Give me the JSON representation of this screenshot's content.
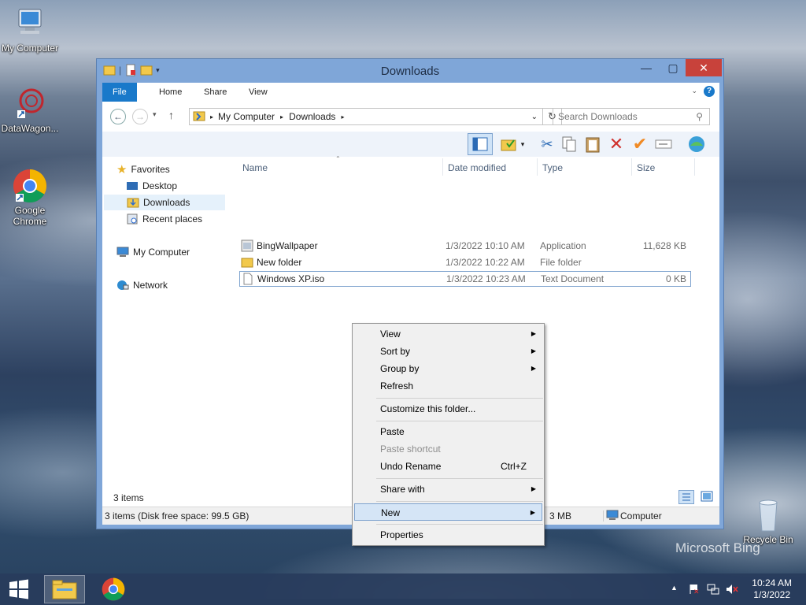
{
  "desktop": {
    "icons": [
      {
        "label": "My Computer"
      },
      {
        "label": "DataWagon..."
      },
      {
        "label": "Google Chrome"
      },
      {
        "label": "Recycle Bin"
      }
    ],
    "watermark": "Microsoft Bing"
  },
  "window": {
    "title": "Downloads",
    "ribbon_tabs": [
      "File",
      "Home",
      "Share",
      "View"
    ],
    "address": {
      "parts": [
        "My Computer",
        "Downloads"
      ]
    },
    "search": {
      "placeholder": "Search Downloads"
    },
    "nav": {
      "favorites": "Favorites",
      "items": [
        "Desktop",
        "Downloads",
        "Recent places"
      ],
      "computer": "My Computer",
      "network": "Network"
    },
    "columns": [
      "Name",
      "Date modified",
      "Type",
      "Size"
    ],
    "files": [
      {
        "name": "BingWallpaper",
        "date": "1/3/2022 10:10 AM",
        "type": "Application",
        "size": "11,628 KB"
      },
      {
        "name": "New folder",
        "date": "1/3/2022 10:22 AM",
        "type": "File folder",
        "size": ""
      },
      {
        "name": "Windows XP.iso",
        "date": "1/3/2022 10:23 AM",
        "type": "Text Document",
        "size": "0 KB"
      }
    ],
    "item_count": "3 items",
    "status": {
      "left": "3 items (Disk free space: 99.5 GB)",
      "mid": "3 MB",
      "right": "Computer"
    }
  },
  "context_menu": {
    "items": [
      {
        "label": "View",
        "submenu": true
      },
      {
        "label": "Sort by",
        "submenu": true
      },
      {
        "label": "Group by",
        "submenu": true
      },
      {
        "label": "Refresh"
      },
      {
        "label": "Customize this folder..."
      },
      {
        "label": "Paste"
      },
      {
        "label": "Paste shortcut",
        "disabled": true
      },
      {
        "label": "Undo Rename",
        "shortcut": "Ctrl+Z"
      },
      {
        "label": "Share with",
        "submenu": true
      },
      {
        "label": "New",
        "submenu": true,
        "highlighted": true
      },
      {
        "label": "Properties"
      }
    ]
  },
  "taskbar": {
    "time": "10:24 AM",
    "date": "1/3/2022"
  }
}
